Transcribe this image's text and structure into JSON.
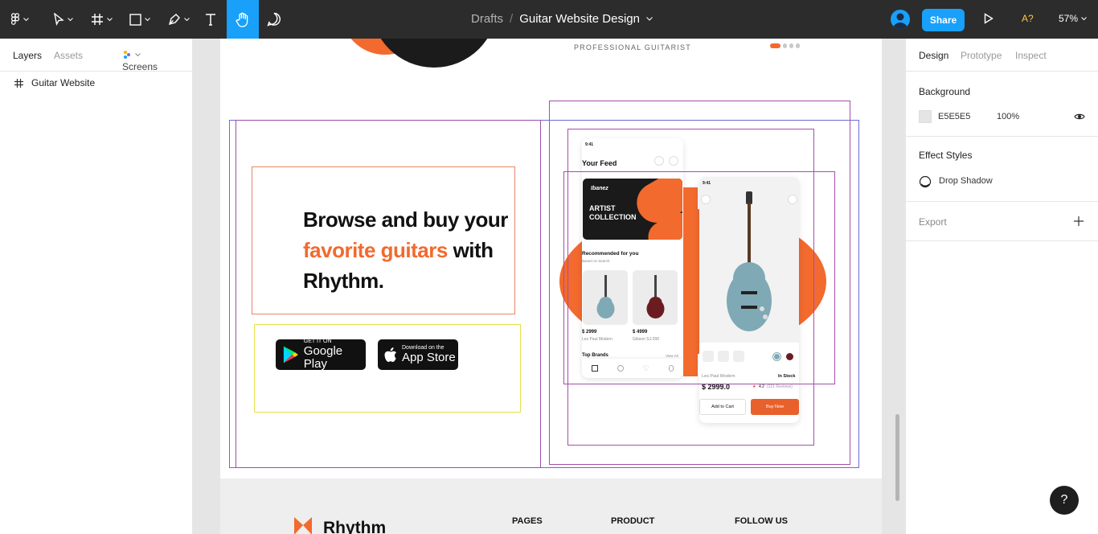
{
  "toolbar": {
    "tools": [
      "figma-menu",
      "move-tool",
      "frame-tool",
      "shape-tool",
      "pen-tool",
      "text-tool",
      "hand-tool",
      "comment-tool"
    ],
    "breadcrumb_root": "Drafts",
    "breadcrumb_sep": "/",
    "file_name": "Guitar Website Design",
    "share_label": "Share",
    "access_label": "A?",
    "zoom_label": "57%"
  },
  "left_panel": {
    "tab_layers": "Layers",
    "tab_assets": "Assets",
    "page_selector": "Screens",
    "layers": [
      {
        "name": "Guitar Website",
        "icon": "frame-icon"
      }
    ]
  },
  "right_panel": {
    "tab_design": "Design",
    "tab_prototype": "Prototype",
    "tab_inspect": "Inspect",
    "background_title": "Background",
    "background_color": "E5E5E5",
    "background_opacity": "100%",
    "effect_styles_title": "Effect Styles",
    "effect_style_name": "Drop Shadow",
    "export_title": "Export"
  },
  "canvas": {
    "hero_subtitle": "PROFESSIONAL GUITARIST",
    "headline_part1": "Browse and buy your",
    "headline_accent": "favorite guitars",
    "headline_part2": "with Rhythm.",
    "google_play_small": "GET IT ON",
    "google_play_big": "Google Play",
    "app_store_small": "Download on the",
    "app_store_big": "App Store",
    "phone1": {
      "time": "9:41",
      "feed_title": "Your Feed",
      "banner_brand": "Ibanez",
      "banner_text": "ARTIST COLLECTION",
      "recommended_title": "Recommended for you",
      "recommended_sub": "Based on Search",
      "product1_price": "$ 2999",
      "product1_name": "Les Paul Modern",
      "product2_price": "$ 4999",
      "product2_name": "Gibson SJ-200",
      "top_brands": "Top Brands",
      "view_all": "View All"
    },
    "phone2": {
      "time": "9:41",
      "product_name": "Les Paul Modern",
      "stock": "In Stock",
      "price": "$ 2999.0",
      "rating": "4.2",
      "reviews": "(321 Reviews)",
      "add_to_cart": "Add to Cart",
      "buy_now": "Buy Now"
    },
    "footer": {
      "brand": "Rhythm",
      "col1": "PAGES",
      "col2": "PRODUCT",
      "col3": "FOLLOW US"
    }
  },
  "help_label": "?",
  "colors": {
    "accent": "#f26a2e",
    "figma_blue": "#18a0fb",
    "toolbar_bg": "#2c2c2c",
    "canvas_bg": "#e5e5e5"
  }
}
